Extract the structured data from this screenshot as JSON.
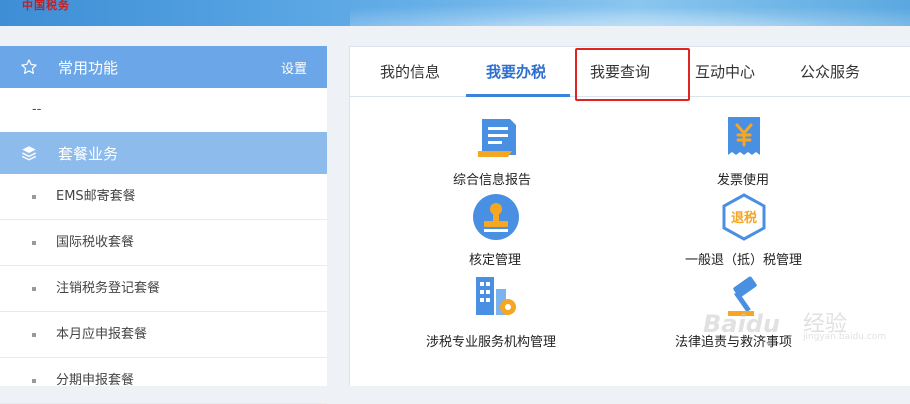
{
  "banner": {
    "logo_text": "中国税务"
  },
  "sidebar": {
    "common": {
      "title": "常用功能",
      "setting_label": "设置",
      "empty_text": "--"
    },
    "packages": {
      "title": "套餐业务",
      "items": [
        {
          "label": "EMS邮寄套餐"
        },
        {
          "label": "国际税收套餐"
        },
        {
          "label": "注销税务登记套餐"
        },
        {
          "label": "本月应申报套餐"
        },
        {
          "label": "分期申报套餐"
        }
      ]
    }
  },
  "tabs": [
    {
      "label": "我的信息",
      "active": false
    },
    {
      "label": "我要办税",
      "active": true
    },
    {
      "label": "我要查询",
      "active": false,
      "highlighted": true
    },
    {
      "label": "互动中心",
      "active": false
    },
    {
      "label": "公众服务",
      "active": false
    }
  ],
  "services": [
    {
      "label": "综合信息报告",
      "icon": "report-document-icon"
    },
    {
      "label": "发票使用",
      "icon": "invoice-yen-icon"
    },
    {
      "label": "核定管理",
      "icon": "stamp-icon"
    },
    {
      "label": "一般退（抵）税管理",
      "icon": "tax-refund-icon"
    },
    {
      "label": "涉税专业服务机构管理",
      "icon": "building-gear-icon"
    },
    {
      "label": "法律追责与救济事项",
      "icon": "gavel-icon"
    }
  ],
  "colors": {
    "accent": "#3b82e0",
    "sidebar_header": "#6aa6e8",
    "highlight_box": "#e02424",
    "icon_blue": "#4a90e2",
    "icon_orange": "#f5a623"
  },
  "watermark": {
    "brand": "Baidu",
    "label": "经验",
    "url": "jingyan.baidu.com"
  }
}
